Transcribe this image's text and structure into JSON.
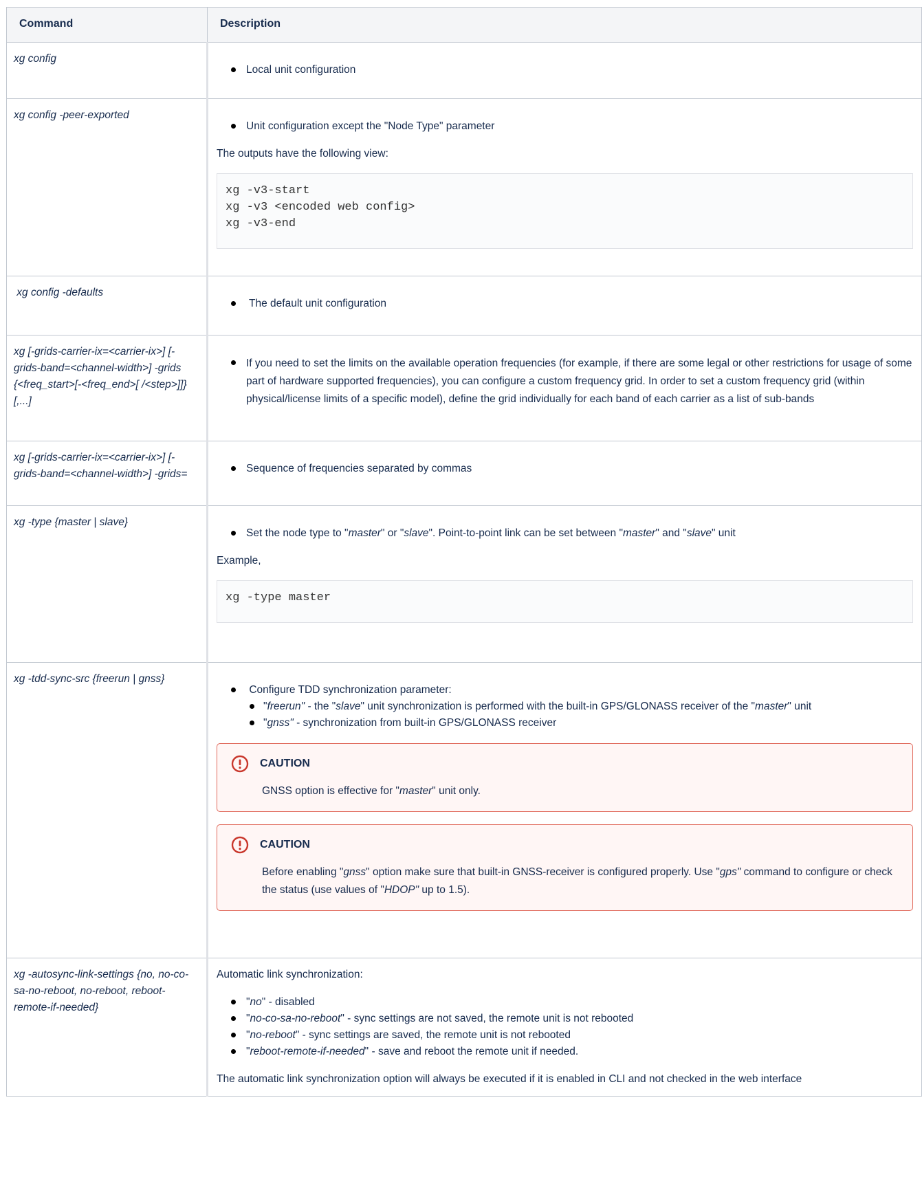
{
  "headers": {
    "command": "Command",
    "description": "Description"
  },
  "rows": {
    "r1": {
      "command": "xg config",
      "bullet": "Local unit configuration"
    },
    "r2": {
      "command": "xg config -peer-exported",
      "bullet": "Unit configuration except the \"Node Type\" parameter",
      "para": "The outputs have the following view:",
      "code": "xg -v3-start\nxg -v3 <encoded web config>\nxg -v3-end"
    },
    "r3": {
      "command": " xg config -defaults",
      "bullet": " The default unit configuration"
    },
    "r4": {
      "command": "xg [-grids-carrier-ix=<carrier-ix>] [-grids-band=<channel-width>] -grids {<freq_start>[-<freq_end>[ /<step>]]}[,...]",
      "bullet": "If you need to set the limits on the available operation frequencies (for example, if there are some legal or other restrictions for usage of some part of hardware supported frequencies), you can configure a custom frequency grid. In order to set a custom frequency grid (within physical/license limits of a specific model), define the grid individually for each band of each carrier as a list of sub-bands"
    },
    "r5": {
      "command": "xg [-grids-carrier-ix=<carrier-ix>] [-grids-band=<channel-width>] -grids=",
      "bullet": "Sequence of frequencies separated by commas"
    },
    "r6": {
      "command": "xg -type {master | slave}",
      "b1": "Set the node type to \"",
      "b_master": "master",
      "b2": "\" or \"",
      "b_slave": "slave",
      "b3": "\". Point-to-point link can be set between \"",
      "b_master2": "master",
      "b4": "\" and \"",
      "b_slave2": "slave",
      "b5": "\" unit",
      "para": "Example,",
      "code": "xg -type master"
    },
    "r7": {
      "command": "xg -tdd-sync-src {freerun | gnss}",
      "bullet": " Configure TDD synchronization parameter:",
      "sub1_a": "\"",
      "sub1_freerun": "freerun\"",
      "sub1_b": " - the \"",
      "sub1_slave": "slave",
      "sub1_c": "\" unit synchronization is performed with the built-in GPS/GLONASS receiver of the \"",
      "sub1_master": "master",
      "sub1_d": "\" unit",
      "sub2_a": "\"",
      "sub2_gnss": "gnss\"",
      "sub2_b": " - synchronization from built-in GPS/GLONASS receiver",
      "caution1_title": "CAUTION",
      "caution1_a": "GNSS option is effective for \"",
      "caution1_master": "master",
      "caution1_b": "\" unit only.",
      "caution2_title": "CAUTION",
      "caution2_a": "Before enabling \"",
      "caution2_gnss": "gnss",
      "caution2_b": "\" option make sure that built-in GNSS-receiver is configured properly. Use \"",
      "caution2_gps": "gps\"",
      "caution2_c": " command to configure or check the status (use values of \"",
      "caution2_hdop": "HDOP\"",
      "caution2_d": " up to 1.5)."
    },
    "r8": {
      "command": "xg -autosync-link-settings {no, no-co-sa-no-reboot, no-reboot, reboot-remote-if-needed}",
      "intro": "Automatic link synchronization:",
      "items": [
        {
          "q": "\"",
          "term": "no",
          "rest": "\" - disabled"
        },
        {
          "q": "\"",
          "term": "no-co-sa-no-reboot",
          "rest": "\" - sync settings are not saved, the remote unit is not rebooted"
        },
        {
          "q": "\"",
          "term": "no-reboot",
          "rest": "\" - sync settings are saved, the remote unit is not rebooted"
        },
        {
          "q": "\"",
          "term": "reboot-remote-if-needed",
          "rest": "\" - save and reboot the remote unit if needed."
        }
      ],
      "outro": "The automatic link synchronization option will always be executed if it is enabled in CLI and not checked in the web interface"
    }
  },
  "colors": {
    "caution_border": "#e0685a",
    "caution_bg": "#fff6f5",
    "header_bg": "#f4f5f7"
  }
}
